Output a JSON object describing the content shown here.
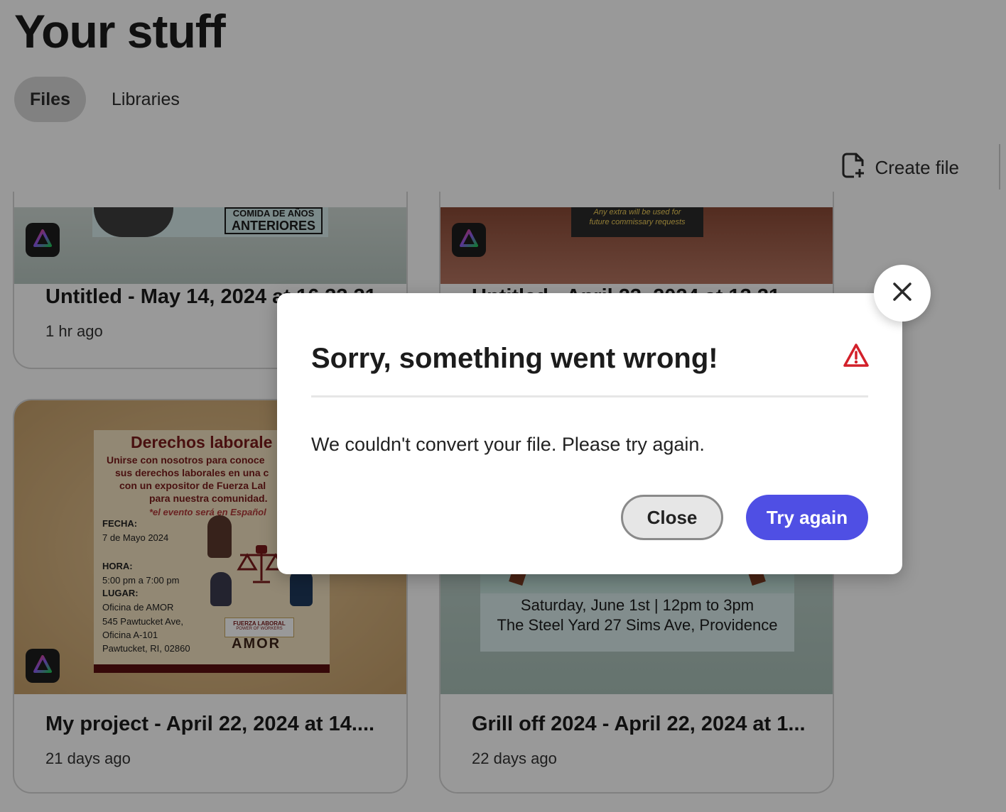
{
  "page": {
    "title": "Your stuff"
  },
  "tabs": [
    {
      "label": "Files",
      "active": true
    },
    {
      "label": "Libraries",
      "active": false
    }
  ],
  "toolbar": {
    "create_label": "Create file"
  },
  "cards": [
    {
      "name": "Untitled - May 14, 2024 at 16.33.31",
      "age": "1 hr ago",
      "thumb_text": [
        "COMIDA DE AÑOS",
        "ANTERIORES"
      ]
    },
    {
      "name": "Untitled - April 23, 2024 at 13.31",
      "age": "",
      "thumb_text": [
        "Any extra will be used for",
        "future commissary requests"
      ]
    },
    {
      "name": "My project - April 22, 2024 at 14....",
      "age": "21 days ago",
      "poster": {
        "heading": "Derechos laborale",
        "lines": [
          "Unirse con nosotros para conoce",
          "sus derechos laborales en una c",
          "con un expositor de Fuerza Lal",
          "para nuestra comunidad."
        ],
        "note": "*el evento será en Español",
        "fecha_label": "FECHA:",
        "fecha": "7 de Mayo 2024",
        "hora_label": "HORA:",
        "hora": "5:00 pm a 7:00 pm",
        "lugar_label": "LUGAR:",
        "lugar": [
          "Oficina de AMOR",
          "545 Pawtucket Ave,",
          "Oficina A-101",
          "Pawtucket, RI, 02860"
        ],
        "logo1": "FUERZA LABORAL",
        "logo1_sub": "POWER OF WORKERS",
        "logo2": "AMOR"
      }
    },
    {
      "name": "Grill off 2024 - April 22, 2024 at 1...",
      "age": "22 days ago",
      "poster_lines": [
        "Saturday, June 1st | 12pm to 3pm",
        "The Steel Yard  27 Sims Ave, Providence"
      ]
    }
  ],
  "dialog": {
    "title": "Sorry, something went wrong!",
    "message": "We couldn't convert your file. Please try again.",
    "close_label": "Close",
    "retry_label": "Try again"
  },
  "colors": {
    "accent": "#4f4fe4",
    "warning": "#d3202a",
    "overlay": "rgba(0,0,0,0.40)"
  }
}
